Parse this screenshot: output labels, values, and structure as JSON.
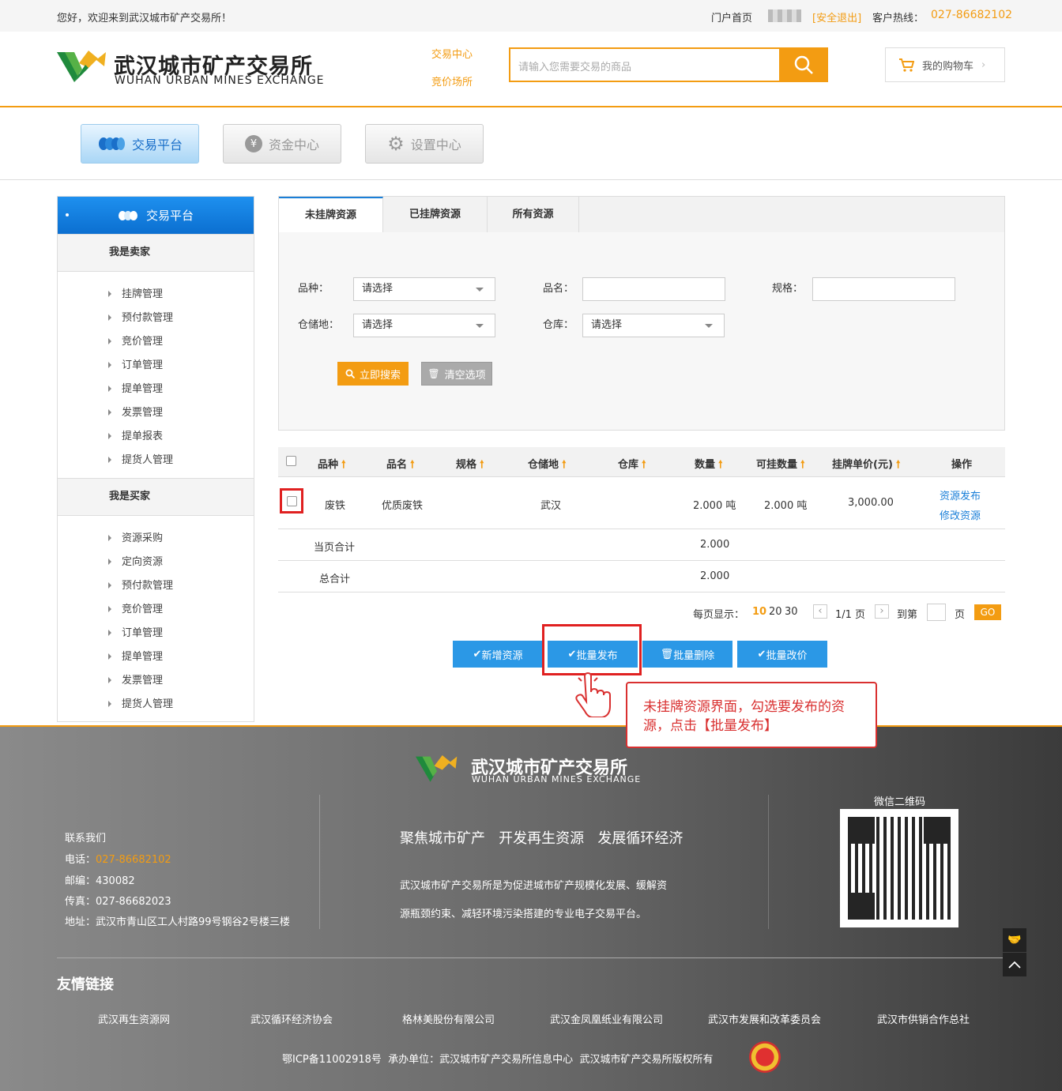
{
  "topbar": {
    "welcome": "您好，欢迎来到武汉城市矿产交易所！",
    "portal_home": "门户首页",
    "logout": "[安全退出]",
    "hotline_label": "客户热线：",
    "hotline": "027-86682102"
  },
  "header": {
    "logo_cn": "武汉城市矿产交易所",
    "logo_en": "WUHAN URBAN MINES EXCHANGE",
    "link_trade": "交易中心",
    "link_auction": "竞价场所",
    "search_placeholder": "请输入您需要交易的商品",
    "cart": "我的购物车"
  },
  "mainnav": {
    "trade": "交易平台",
    "funds": "资金中心",
    "settings": "设置中心"
  },
  "sidebar": {
    "title": "交易平台",
    "seller": "我是卖家",
    "seller_items": [
      "挂牌管理",
      "预付款管理",
      "竞价管理",
      "订单管理",
      "提单管理",
      "发票管理",
      "提单报表",
      "提货人管理"
    ],
    "buyer": "我是买家",
    "buyer_items": [
      "资源采购",
      "定向资源",
      "预付款管理",
      "竞价管理",
      "订单管理",
      "提单管理",
      "发票管理",
      "提货人管理"
    ]
  },
  "tabs": [
    "未挂牌资源",
    "已挂牌资源",
    "所有资源"
  ],
  "filters": {
    "variety_label": "品种：",
    "variety_value": "请选择",
    "name_label": "品名：",
    "spec_label": "规格：",
    "storage_label": "仓储地：",
    "storage_value": "请选择",
    "warehouse_label": "仓库：",
    "warehouse_value": "请选择",
    "search_btn": "立即搜索",
    "clear_btn": "清空选项"
  },
  "table": {
    "headers": [
      "品种",
      "品名",
      "规格",
      "仓储地",
      "仓库",
      "数量",
      "可挂数量",
      "挂牌单价(元)",
      "操作"
    ],
    "row": {
      "variety": "废铁",
      "name": "优质废铁",
      "spec": "",
      "storage": "武汉",
      "warehouse": "",
      "qty": "2.000 吨",
      "avail": "2.000 吨",
      "price": "3,000.00",
      "op1": "资源发布",
      "op2": "修改资源"
    },
    "page_total_label": "当页合计",
    "page_total": "2.000",
    "grand_total_label": "总合计",
    "grand_total": "2.000"
  },
  "pager": {
    "per_page_label": "每页显示：",
    "opt10": "10",
    "opt20": "20",
    "opt30": "30",
    "pages": "1/1 页",
    "goto": "到第",
    "page_unit": "页",
    "go": "GO"
  },
  "actions": {
    "add": "新增资源",
    "batch_publish": "批量发布",
    "batch_delete": "批量删除",
    "batch_price": "批量改价"
  },
  "callout": "未挂牌资源界面，勾选要发布的资源，点击【批量发布】",
  "footer": {
    "logo_cn": "武汉城市矿产交易所",
    "logo_en": "WUHAN URBAN MINES EXCHANGE",
    "contact_title": "联系我们",
    "phone_label": "电话：",
    "phone": "027-86682102",
    "postcode": "邮编：430082",
    "fax": "传真：027-86682023",
    "address": "地址：武汉市青山区工人村路99号钢谷2号楼三楼",
    "slogan": "聚焦城市矿产   开发再生资源   发展循环经济",
    "desc1": "武汉城市矿产交易所是为促进城市矿产规模化发展、缓解资",
    "desc2": "源瓶颈约束、减轻环境污染搭建的专业电子交易平台。",
    "qr_title": "微信二维码",
    "links_title": "友情链接",
    "links": [
      "武汉再生资源网",
      "武汉循环经济协会",
      "格林美股份有限公司",
      "武汉金凤凰纸业有限公司",
      "武汉市发展和改革委员会",
      "武汉市供销合作总社"
    ],
    "icp": "鄂ICP备11002918号  承办单位：武汉城市矿产交易所信息中心  武汉城市矿产交易所版权所有"
  },
  "colors": {
    "accent": "#f39c12",
    "blue": "#2b98e6",
    "link": "#1a7fd8",
    "red": "#e02020"
  }
}
